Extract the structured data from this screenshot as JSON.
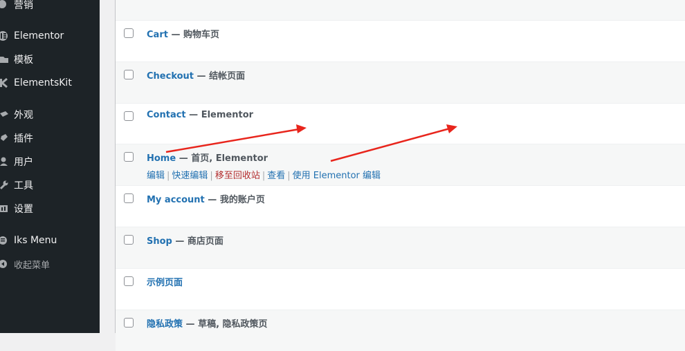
{
  "sidebar": {
    "items": [
      {
        "label": "营销",
        "icon": "megaphone-icon"
      },
      {
        "label": "Elementor",
        "icon": "elementor-icon"
      },
      {
        "label": "模板",
        "icon": "folder-icon"
      },
      {
        "label": "ElementsKit",
        "icon": "elementskit-icon"
      },
      {
        "label": "外观",
        "icon": "paintbrush-icon"
      },
      {
        "label": "插件",
        "icon": "plugin-icon"
      },
      {
        "label": "用户",
        "icon": "user-icon"
      },
      {
        "label": "工具",
        "icon": "wrench-icon"
      },
      {
        "label": "设置",
        "icon": "settings-icon"
      },
      {
        "label": "Iks Menu",
        "icon": "iks-menu-icon"
      },
      {
        "label": "收起菜单",
        "icon": "collapse-icon"
      }
    ]
  },
  "pages": [
    {
      "title": "Cart",
      "dash": " — ",
      "state": "购物车页"
    },
    {
      "title": "Checkout",
      "dash": " — ",
      "state": "结帐页面"
    },
    {
      "title": "Contact",
      "dash": " — ",
      "state": "Elementor"
    },
    {
      "title": "Home",
      "dash": " — ",
      "state": "首页, Elementor"
    },
    {
      "title": "My account",
      "dash": " — ",
      "state": "我的账户页"
    },
    {
      "title": "Shop",
      "dash": " — ",
      "state": "商店页面"
    },
    {
      "title": "示例页面",
      "dash": "",
      "state": ""
    },
    {
      "title": "隐私政策",
      "dash": " — ",
      "state": "草稿, 隐私政策页"
    }
  ],
  "row_actions": {
    "edit": "编辑",
    "quick_edit": "快速编辑",
    "trash": "移至回收站",
    "view": "查看",
    "edit_with_elementor": "使用 Elementor 编辑",
    "separator": "|"
  },
  "colors": {
    "sidebar_bg": "#1d2327",
    "link": "#2271b1",
    "trash": "#b32d2e",
    "annotation_arrow": "#e8251c"
  }
}
